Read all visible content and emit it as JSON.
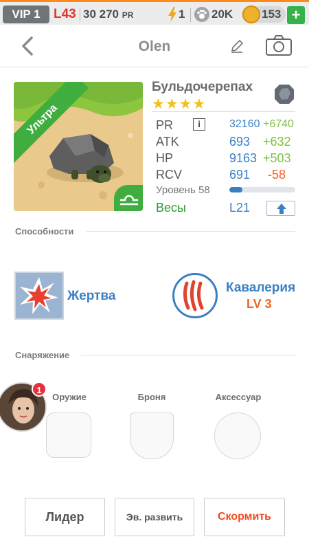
{
  "topbar": {
    "vip": "VIP 1",
    "level": "L43",
    "pr_value": "30 270",
    "pr_unit": "PR",
    "energy": "1",
    "food": "20K",
    "gems": "153",
    "plus": "+"
  },
  "header": {
    "title": "Olen"
  },
  "pet": {
    "rarity": "Ультра",
    "name": "Бульдочерепах",
    "stars": "★★★★",
    "stats": [
      {
        "label": "PR",
        "base": "32160",
        "bonus": "+6740"
      },
      {
        "label": "ATK",
        "base": "693",
        "bonus": "+632"
      },
      {
        "label": "HP",
        "base": "9163",
        "bonus": "+503"
      },
      {
        "label": "RCV",
        "base": "691",
        "bonus": "-58"
      }
    ],
    "info": "i",
    "level_label": "Уровень 58",
    "level_progress": 0.2,
    "zodiac": "Весы",
    "pet_level": "L21"
  },
  "abilities": {
    "title": "Способности",
    "items": [
      {
        "name": "Жертва"
      },
      {
        "name": "Кавалерия",
        "level": "LV 3"
      }
    ]
  },
  "equipment": {
    "title": "Снаряжение",
    "slots": [
      "Оружие",
      "Броня",
      "Аксессуар"
    ]
  },
  "avatar": {
    "badge": "1"
  },
  "buttons": {
    "leader": "Лидер",
    "evolve": "Эв. развить",
    "feed": "Скормить"
  },
  "colors": {
    "accent_blue": "#3a7fc4",
    "positive_green": "#7cc243",
    "negative_orange": "#f26522",
    "rarity_green": "#3fae3f"
  }
}
